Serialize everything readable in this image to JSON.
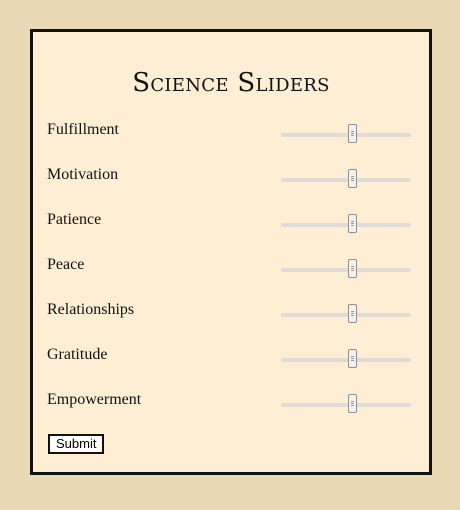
{
  "form": {
    "title": "Science Sliders",
    "submit_label": "Submit"
  },
  "sliders": [
    {
      "label": "Fulfillment",
      "value": 55
    },
    {
      "label": "Motivation",
      "value": 55
    },
    {
      "label": "Patience",
      "value": 55
    },
    {
      "label": "Peace",
      "value": 55
    },
    {
      "label": "Relationships",
      "value": 55
    },
    {
      "label": "Gratitude",
      "value": 55
    },
    {
      "label": "Empowerment",
      "value": 55
    }
  ],
  "colors": {
    "page_background": "#e8dab4",
    "panel_background": "#feefd4",
    "border": "#111111"
  }
}
